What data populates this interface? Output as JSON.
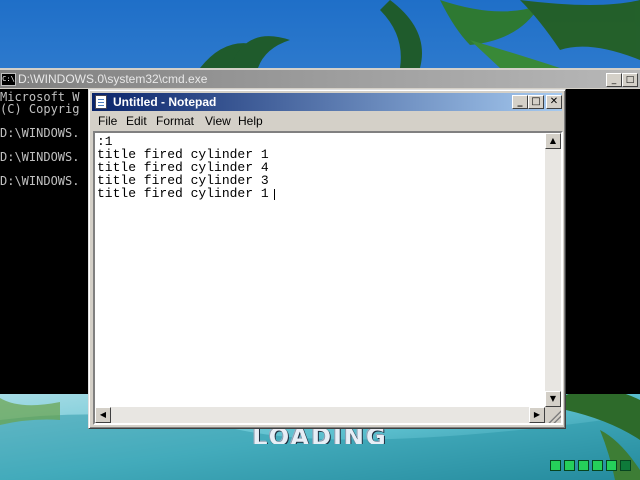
{
  "desktop": {
    "banner_text": "LOADING"
  },
  "cmd": {
    "title": "D:\\WINDOWS.0\\system32\\cmd.exe",
    "icon_label": "C:\\",
    "lines": [
      "Microsoft W",
      "(C) Copyrig",
      "D:\\WINDOWS.",
      "D:\\WINDOWS.",
      "D:\\WINDOWS."
    ],
    "minimize_label": "_",
    "maximize_label": "□"
  },
  "notepad": {
    "title": "Untitled - Notepad",
    "controls": {
      "minimize": "_",
      "maximize": "□",
      "close": "✕"
    },
    "menu": [
      "File",
      "Edit",
      "Format",
      "View",
      "Help"
    ],
    "lines": [
      ":1",
      "title fired cylinder 1",
      "title fired cylinder 4",
      "title fired cylinder 3",
      "title fired cylinder 1"
    ],
    "scroll": {
      "up": "▲",
      "down": "▼",
      "left": "◀",
      "right": "▶"
    }
  }
}
